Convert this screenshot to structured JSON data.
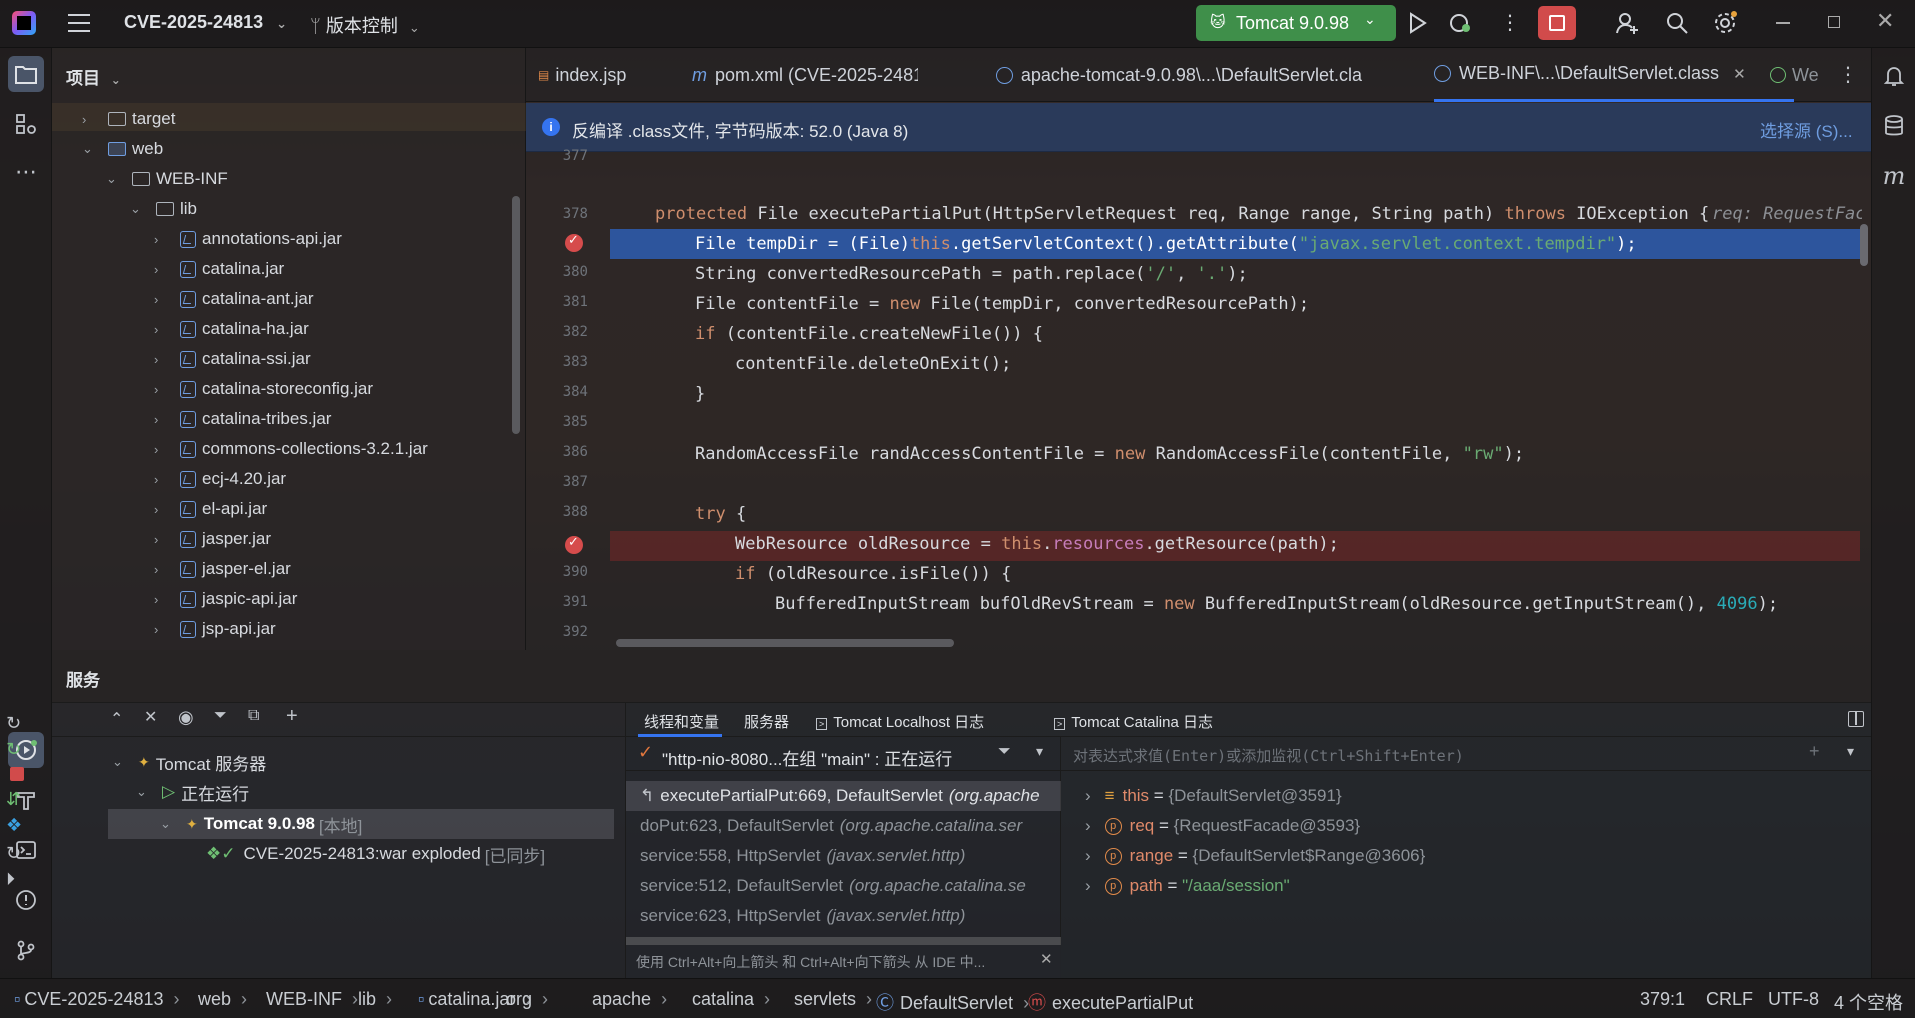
{
  "titlebar": {
    "project": "CVE-2025-24813",
    "vcs": "版本控制",
    "run_config": "Tomcat 9.0.98"
  },
  "project_panel": {
    "title": "项目",
    "items": [
      {
        "label": "target",
        "type": "folder"
      },
      {
        "label": "web",
        "type": "webfolder"
      },
      {
        "label": "WEB-INF",
        "type": "folder"
      },
      {
        "label": "lib",
        "type": "folder"
      },
      {
        "label": "annotations-api.jar",
        "type": "jar"
      },
      {
        "label": "catalina.jar",
        "type": "jar"
      },
      {
        "label": "catalina-ant.jar",
        "type": "jar"
      },
      {
        "label": "catalina-ha.jar",
        "type": "jar"
      },
      {
        "label": "catalina-ssi.jar",
        "type": "jar"
      },
      {
        "label": "catalina-storeconfig.jar",
        "type": "jar"
      },
      {
        "label": "catalina-tribes.jar",
        "type": "jar"
      },
      {
        "label": "commons-collections-3.2.1.jar",
        "type": "jar"
      },
      {
        "label": "ecj-4.20.jar",
        "type": "jar"
      },
      {
        "label": "el-api.jar",
        "type": "jar"
      },
      {
        "label": "jasper.jar",
        "type": "jar"
      },
      {
        "label": "jasper-el.jar",
        "type": "jar"
      },
      {
        "label": "jaspic-api.jar",
        "type": "jar"
      },
      {
        "label": "jsp-api.jar",
        "type": "jar"
      }
    ]
  },
  "tabs": [
    "index.jsp",
    "pom.xml (CVE-2025-2481",
    "apache-tomcat-9.0.98\\...\\DefaultServlet.cla",
    "WEB-INF\\...\\DefaultServlet.class",
    "We"
  ],
  "banner": {
    "text": "反编译 .class文件, 字节码版本: 52.0 (Java 8)",
    "action": "选择源 (S)..."
  },
  "code": {
    "lines": [
      {
        "n": "377"
      },
      {
        "n": "378"
      },
      {
        "n": "379"
      },
      {
        "n": "380"
      },
      {
        "n": "381"
      },
      {
        "n": "382"
      },
      {
        "n": "383"
      },
      {
        "n": "384"
      },
      {
        "n": "385"
      },
      {
        "n": "386"
      },
      {
        "n": "387"
      },
      {
        "n": "388"
      },
      {
        "n": "389"
      },
      {
        "n": "390"
      },
      {
        "n": "391"
      },
      {
        "n": "392"
      }
    ],
    "text": {
      "l378": "protected File executePartialPut(HttpServletRequest req, Range range, String path) throws IOException {",
      "hint378": "req: RequestFac",
      "l379": "File tempDir = (File)this.getServletContext().getAttribute(\"javax.servlet.context.tempdir\");",
      "l380": "String convertedResourcePath = path.replace('/', '.');",
      "l381": "File contentFile = new File(tempDir, convertedResourcePath);",
      "l382": "if (contentFile.createNewFile()) {",
      "l383": "contentFile.deleteOnExit();",
      "l384": "}",
      "l386": "RandomAccessFile randAccessContentFile = new RandomAccessFile(contentFile, \"rw\");",
      "l388": "try {",
      "l389": "WebResource oldResource = this.resources.getResource(path);",
      "l390": "if (oldResource.isFile()) {",
      "l391": "BufferedInputStream bufOldRevStream = new BufferedInputStream(oldResource.getInputStream(), 4096);"
    }
  },
  "services": {
    "title": "服务",
    "tree": {
      "root": "Tomcat 服务器",
      "running": "正在运行",
      "server": "Tomcat 9.0.98",
      "server_tag": "[本地]",
      "artifact": "CVE-2025-24813:war exploded",
      "artifact_tag": "[已同步]"
    }
  },
  "debug": {
    "tabs": [
      "线程和变量",
      "服务器",
      "Tomcat Localhost 日志",
      "Tomcat Catalina 日志"
    ],
    "thread": "\"http-nio-8080...在组 \"main\" : 正在运行",
    "eval_placeholder": "对表达式求值(Enter)或添加监视(Ctrl+Shift+Enter)",
    "frames": [
      {
        "method": "executePartialPut:669, DefaultServlet",
        "pkg": "(org.apache"
      },
      {
        "method": "doPut:623, DefaultServlet",
        "pkg": "(org.apache.catalina.ser"
      },
      {
        "method": "service:558, HttpServlet",
        "pkg": "(javax.servlet.http)"
      },
      {
        "method": "service:512, DefaultServlet",
        "pkg": "(org.apache.catalina.se"
      },
      {
        "method": "service:623, HttpServlet",
        "pkg": "(javax.servlet.http)"
      }
    ],
    "frames_hint": "使用 Ctrl+Alt+向上箭头 和 Ctrl+Alt+向下箭头 从 IDE 中...",
    "vars": [
      {
        "name": "this",
        "value": "{DefaultServlet@3591}"
      },
      {
        "name": "req",
        "value": "{RequestFacade@3593}"
      },
      {
        "name": "range",
        "value": "{DefaultServlet$Range@3606}"
      },
      {
        "name": "path",
        "value": "\"/aaa/session\""
      }
    ]
  },
  "statusbar": {
    "crumbs": [
      "CVE-2025-24813",
      "web",
      "WEB-INF",
      "lib",
      "catalina.jar",
      "org",
      "apache",
      "catalina",
      "servlets",
      "DefaultServlet",
      "executePartialPut"
    ],
    "position": "379:1",
    "line_sep": "CRLF",
    "encoding": "UTF-8",
    "indent": "4 个空格"
  },
  "colors": {
    "accent": "#3574f0",
    "run_green": "#3f8f4a",
    "stop_red": "#d14b4b",
    "highlight": "#2d5eb3"
  }
}
